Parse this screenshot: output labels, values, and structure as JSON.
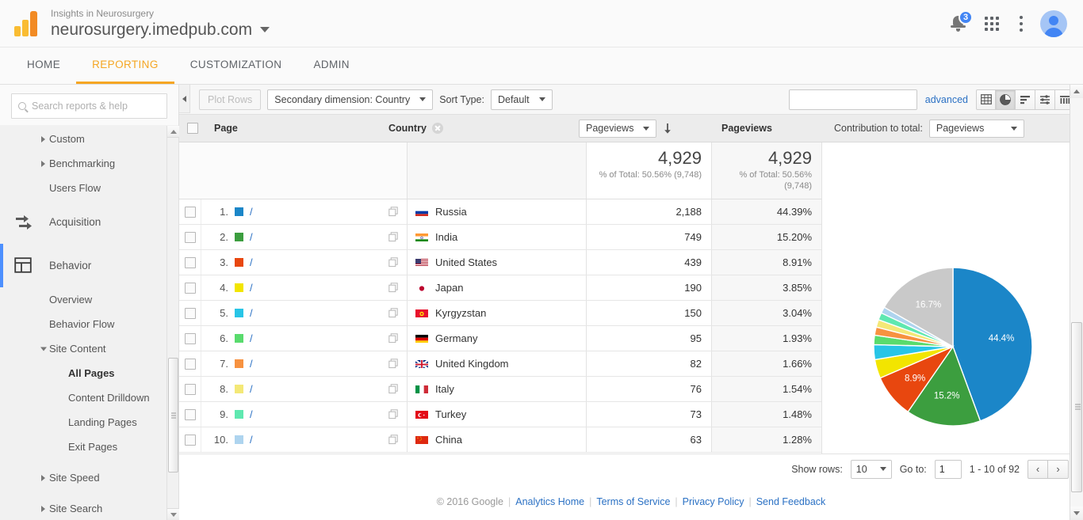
{
  "header": {
    "account_name": "Insights in Neurosurgery",
    "property_name": "neurosurgery.imedpub.com",
    "notification_count": "3",
    "icons": {
      "logo": "google-analytics-logo",
      "bell": "notifications-bell-icon",
      "apps": "apps-grid-icon",
      "more": "more-options-icon",
      "avatar": "user-avatar"
    }
  },
  "nav_tabs": [
    {
      "label": "HOME",
      "active": false
    },
    {
      "label": "REPORTING",
      "active": true
    },
    {
      "label": "CUSTOMIZATION",
      "active": false
    },
    {
      "label": "ADMIN",
      "active": false
    }
  ],
  "sidebar": {
    "search_placeholder": "Search reports & help",
    "items": [
      {
        "label": "Custom",
        "type": "group-collapsed",
        "indent": 1
      },
      {
        "label": "Benchmarking",
        "type": "group-collapsed",
        "indent": 1
      },
      {
        "label": "Users Flow",
        "type": "leaf",
        "indent": 1
      },
      {
        "label": "Acquisition",
        "type": "section",
        "icon": "acquisition-icon"
      },
      {
        "label": "Behavior",
        "type": "section",
        "icon": "behavior-icon",
        "active": true
      },
      {
        "label": "Overview",
        "type": "leaf",
        "indent": 1
      },
      {
        "label": "Behavior Flow",
        "type": "leaf",
        "indent": 1
      },
      {
        "label": "Site Content",
        "type": "group-expanded",
        "indent": 1
      },
      {
        "label": "All Pages",
        "type": "leaf",
        "indent": 2,
        "selected": true
      },
      {
        "label": "Content Drilldown",
        "type": "leaf",
        "indent": 2
      },
      {
        "label": "Landing Pages",
        "type": "leaf",
        "indent": 2
      },
      {
        "label": "Exit Pages",
        "type": "leaf",
        "indent": 2
      },
      {
        "label": "Site Speed",
        "type": "group-collapsed",
        "indent": 1
      },
      {
        "label": "Site Search",
        "type": "group-collapsed",
        "indent": 1
      }
    ]
  },
  "toolbar": {
    "plot_rows_label": "Plot Rows",
    "secondary_dimension_label": "Secondary dimension: Country",
    "sort_type_label": "Sort Type:",
    "sort_type_value": "Default",
    "search_value": "",
    "advanced_label": "advanced",
    "view_buttons": [
      {
        "name": "table-view-icon",
        "active": false
      },
      {
        "name": "pie-chart-view-icon",
        "active": true
      },
      {
        "name": "performance-view-icon",
        "active": false
      },
      {
        "name": "comparison-view-icon",
        "active": false
      },
      {
        "name": "pivot-view-icon",
        "active": false
      }
    ]
  },
  "table": {
    "col_page": "Page",
    "col_country": "Country",
    "metric_select": "Pageviews",
    "col_pageviews": "Pageviews",
    "contribution_label": "Contribution to total:",
    "contribution_value": "Pageviews",
    "summary": {
      "value1": "4,929",
      "sub1": "% of Total: 50.56% (9,748)",
      "value2": "4,929",
      "sub2": "% of Total: 50.56% (9,748)"
    },
    "rows": [
      {
        "rank": "1.",
        "page": "/",
        "country": "Russia",
        "pageviews": "2,188",
        "percent": "44.39%",
        "color": "#1b86c8",
        "flag": "ru"
      },
      {
        "rank": "2.",
        "page": "/",
        "country": "India",
        "pageviews": "749",
        "percent": "15.20%",
        "color": "#3c9e3f",
        "flag": "in"
      },
      {
        "rank": "3.",
        "page": "/",
        "country": "United States",
        "pageviews": "439",
        "percent": "8.91%",
        "color": "#e8470f",
        "flag": "us"
      },
      {
        "rank": "4.",
        "page": "/",
        "country": "Japan",
        "pageviews": "190",
        "percent": "3.85%",
        "color": "#f2e500",
        "flag": "jp"
      },
      {
        "rank": "5.",
        "page": "/",
        "country": "Kyrgyzstan",
        "pageviews": "150",
        "percent": "3.04%",
        "color": "#28c5e6",
        "flag": "kg"
      },
      {
        "rank": "6.",
        "page": "/",
        "country": "Germany",
        "pageviews": "95",
        "percent": "1.93%",
        "color": "#59db6d",
        "flag": "de"
      },
      {
        "rank": "7.",
        "page": "/",
        "country": "United Kingdom",
        "pageviews": "82",
        "percent": "1.66%",
        "color": "#f79240",
        "flag": "gb"
      },
      {
        "rank": "8.",
        "page": "/",
        "country": "Italy",
        "pageviews": "76",
        "percent": "1.54%",
        "color": "#f4e877",
        "flag": "it"
      },
      {
        "rank": "9.",
        "page": "/",
        "country": "Turkey",
        "pageviews": "73",
        "percent": "1.48%",
        "color": "#5fe8b0",
        "flag": "tr"
      },
      {
        "rank": "10.",
        "page": "/",
        "country": "China",
        "pageviews": "63",
        "percent": "1.28%",
        "color": "#aed4ef",
        "flag": "cn"
      }
    ]
  },
  "chart_data": {
    "type": "pie",
    "title": "",
    "labels": [
      "Russia",
      "India",
      "United States",
      "Japan",
      "Kyrgyzstan",
      "Germany",
      "United Kingdom",
      "Italy",
      "Turkey",
      "China",
      "Other"
    ],
    "values": [
      44.4,
      15.2,
      8.9,
      3.85,
      3.04,
      1.93,
      1.66,
      1.54,
      1.48,
      1.28,
      16.7
    ],
    "raw_values": [
      2188,
      749,
      439,
      190,
      150,
      95,
      82,
      76,
      73,
      63,
      824
    ],
    "colors": [
      "#1b86c8",
      "#3c9e3f",
      "#e8470f",
      "#f2e500",
      "#28c5e6",
      "#59db6d",
      "#f79240",
      "#f4e877",
      "#5fe8b0",
      "#aed4ef",
      "#c9c9c9"
    ],
    "visible_labels": [
      {
        "text": "44.4%",
        "slice": "Russia"
      },
      {
        "text": "15.2%",
        "slice": "India"
      },
      {
        "text": "8.9%",
        "slice": "United States"
      },
      {
        "text": "16.7%",
        "slice": "Other"
      }
    ],
    "legend": "none",
    "metric": "Pageviews",
    "total": 4929
  },
  "pager": {
    "show_rows_label": "Show rows:",
    "show_rows_value": "10",
    "go_to_label": "Go to:",
    "go_to_value": "1",
    "range_label": "1 - 10 of 92",
    "prev": "‹",
    "next": "›"
  },
  "footer": {
    "copyright": "© 2016 Google",
    "links": [
      "Analytics Home",
      "Terms of Service",
      "Privacy Policy",
      "Send Feedback"
    ]
  }
}
